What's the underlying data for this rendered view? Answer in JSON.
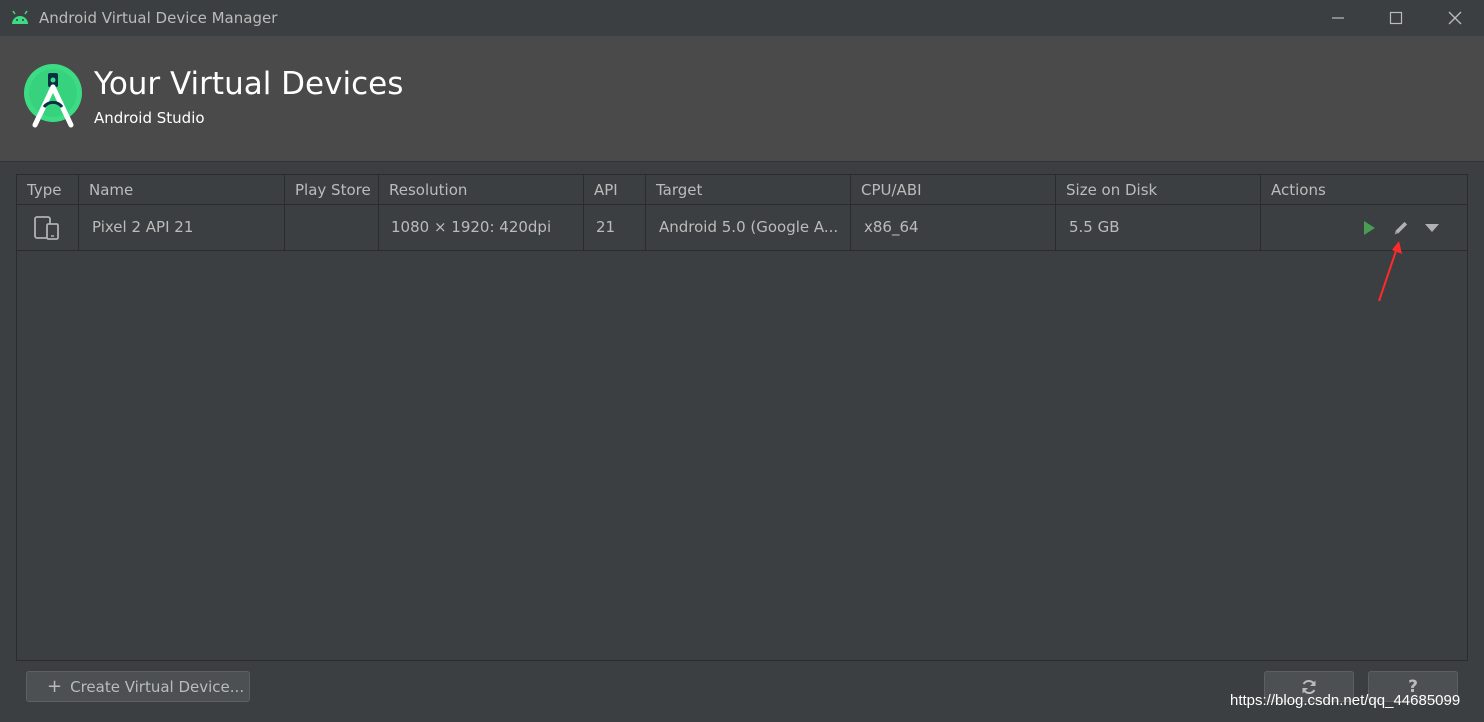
{
  "window": {
    "title": "Android Virtual Device Manager"
  },
  "header": {
    "title": "Your Virtual Devices",
    "subtitle": "Android Studio"
  },
  "table": {
    "columns": [
      "Type",
      "Name",
      "Play Store",
      "Resolution",
      "API",
      "Target",
      "CPU/ABI",
      "Size on Disk",
      "Actions"
    ],
    "rows": [
      {
        "type_icon": "phone-tablet-icon",
        "name": "Pixel 2 API 21",
        "play_store": "",
        "resolution": "1080 × 1920: 420dpi",
        "api": "21",
        "target": "Android 5.0 (Google A...",
        "cpu_abi": "x86_64",
        "size_on_disk": "5.5 GB",
        "actions": [
          "play-icon",
          "pencil-icon",
          "chevron-down-icon"
        ]
      }
    ]
  },
  "footer": {
    "create_label": "Create Virtual Device...",
    "refresh_icon": "refresh-icon",
    "help_label": "?"
  },
  "watermark": "https://blog.csdn.net/qq_44685099",
  "colors": {
    "background": "#3c3f41",
    "banner": "#4a4a4a",
    "text": "#bbbbbb",
    "play": "#499c54",
    "android_green": "#3ddc84",
    "annotation_arrow": "#ff2a2a"
  }
}
